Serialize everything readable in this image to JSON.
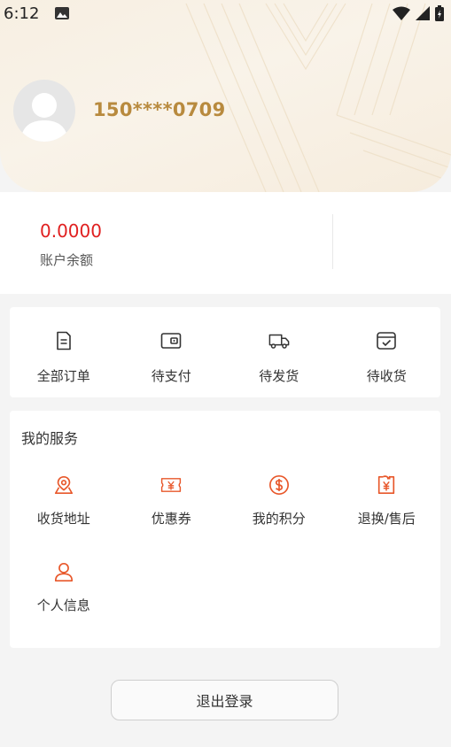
{
  "status_bar": {
    "time": "6:12"
  },
  "profile": {
    "phone": "150****0709"
  },
  "account": {
    "balance": "0.0000",
    "balance_label": "账户余额"
  },
  "orders": {
    "items": [
      {
        "label": "全部订单",
        "icon": "document-icon"
      },
      {
        "label": "待支付",
        "icon": "wallet-icon"
      },
      {
        "label": "待发货",
        "icon": "truck-icon"
      },
      {
        "label": "待收货",
        "icon": "box-check-icon"
      }
    ]
  },
  "services": {
    "title": "我的服务",
    "items": [
      {
        "label": "收货地址",
        "icon": "map-pin-icon"
      },
      {
        "label": "优惠券",
        "icon": "coupon-icon"
      },
      {
        "label": "我的积分",
        "icon": "dollar-coin-icon"
      },
      {
        "label": "退换/售后",
        "icon": "refund-icon"
      },
      {
        "label": "个人信息",
        "icon": "user-icon"
      }
    ]
  },
  "logout_label": "退出登录",
  "colors": {
    "accent": "#e8572a",
    "gold": "#b88a3e",
    "balance": "#e02020"
  }
}
